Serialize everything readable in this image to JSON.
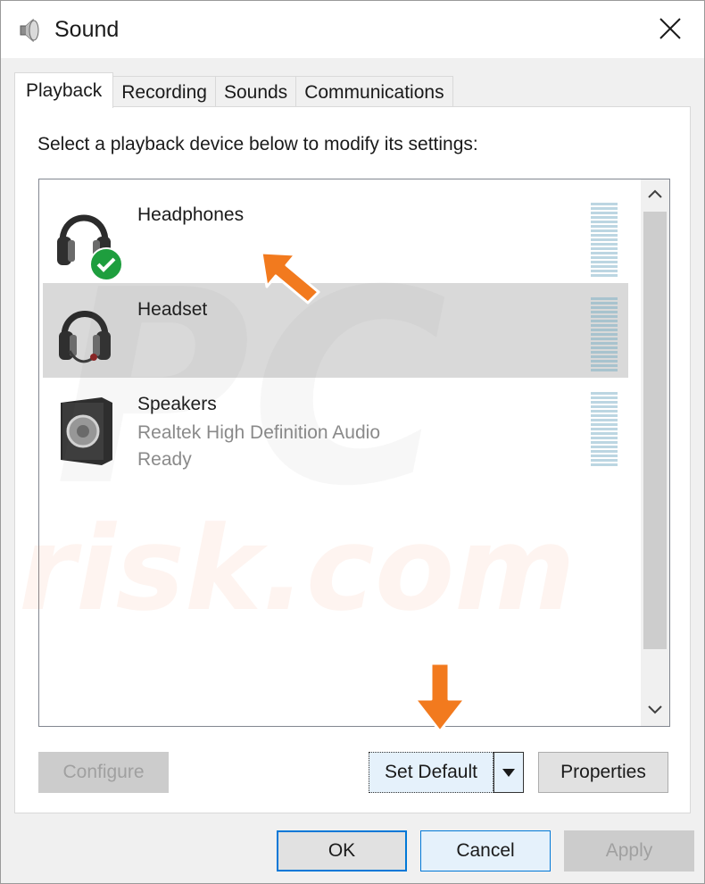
{
  "window": {
    "title": "Sound",
    "icon": "speaker-icon",
    "close_icon": "close-icon"
  },
  "tabs": [
    {
      "label": "Playback",
      "active": true
    },
    {
      "label": "Recording",
      "active": false
    },
    {
      "label": "Sounds",
      "active": false
    },
    {
      "label": "Communications",
      "active": false
    }
  ],
  "instruction": "Select a playback device below to modify its settings:",
  "devices": [
    {
      "name": "Headphones",
      "description": "",
      "status": "",
      "icon": "headphones-icon",
      "default": true,
      "selected": false
    },
    {
      "name": "Headset",
      "description": "",
      "status": "",
      "icon": "headset-icon",
      "default": false,
      "selected": true
    },
    {
      "name": "Speakers",
      "description": "Realtek High Definition Audio",
      "status": "Ready",
      "icon": "speaker-box-icon",
      "default": false,
      "selected": false
    }
  ],
  "buttons": {
    "configure": "Configure",
    "set_default": "Set Default",
    "properties": "Properties",
    "ok": "OK",
    "cancel": "Cancel",
    "apply": "Apply"
  },
  "watermark": {
    "line1": "PC",
    "line2": "risk.com"
  },
  "colors": {
    "accent": "#0078d7",
    "annotation_arrow": "#f27a1e",
    "default_check": "#1e9e3e",
    "selected_row": "#d9d9d9"
  }
}
